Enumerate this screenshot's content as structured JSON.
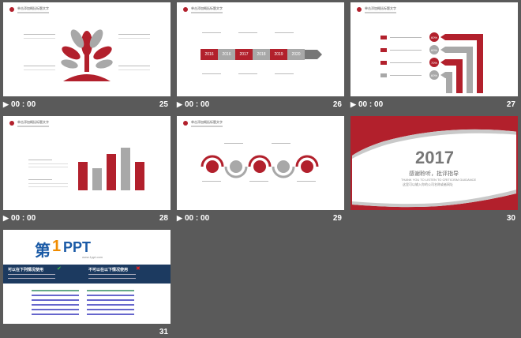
{
  "slides": [
    {
      "num": "25",
      "time": "00 : 00",
      "title": "单击添加概括标题文字"
    },
    {
      "num": "26",
      "time": "00 : 00",
      "title": "单击添加概括标题文字",
      "years": [
        "2016",
        "2016",
        "2017",
        "2018",
        "2019",
        "2020"
      ]
    },
    {
      "num": "27",
      "time": "00 : 00",
      "title": "单击添加概括标题文字",
      "percents": [
        "60%",
        "60%",
        "70%",
        "60%"
      ]
    },
    {
      "num": "28",
      "time": "00 : 00",
      "title": "单击添加概括标题文字"
    },
    {
      "num": "29",
      "time": "00 : 00",
      "title": "单击添加概括标题文字"
    },
    {
      "num": "30",
      "time": "00 : 00",
      "year": "2017",
      "thanks": "感谢聆听，批评指导",
      "thanks_en": "THANK YOU TO LISTEN TO CRITICISM GUIDANCE",
      "sub": "这里可以输入你的公司名称或者网址"
    },
    {
      "num": "31",
      "time": "",
      "logo_a": "第",
      "logo_b": "1",
      "logo_c": "PPT",
      "logo_url": "www.1ppt.com",
      "can": "可以在下列情况使用",
      "cannot": "不可以在以下情况使用"
    }
  ],
  "icons": {
    "time": "film-icon"
  },
  "colors": {
    "accent": "#b2202c",
    "bg": "#5a5a5a"
  }
}
